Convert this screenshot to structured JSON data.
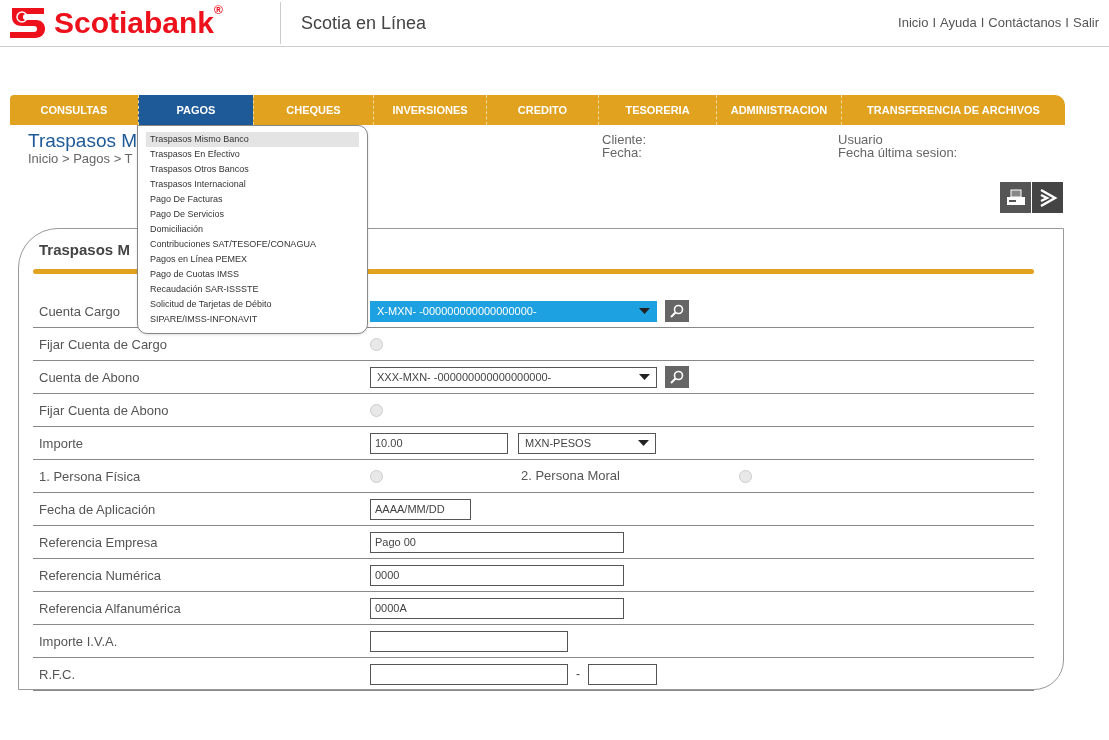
{
  "header": {
    "brand": "Scotiabank$^{®}$",
    "product": "Scotia en Línea",
    "links": [
      "Inicio",
      "Ayuda",
      "Contáctanos",
      "Salir"
    ],
    "separators": [
      "I",
      "I",
      "I"
    ]
  },
  "nav": [
    {
      "label": "CONSULTAS",
      "selected": false
    },
    {
      "label": "PAGOS",
      "selected": true
    },
    {
      "label": "CHEQUES",
      "selected": false
    },
    {
      "label": "INVERSIONES",
      "selected": false
    },
    {
      "label": "CREDITO",
      "selected": false
    },
    {
      "label": "TESORERIA",
      "selected": false
    },
    {
      "label": "ADMINISTRACION",
      "selected": false
    },
    {
      "label": "TRANSFERENCIA DE ARCHIVOS",
      "selected": false
    }
  ],
  "menu": [
    {
      "label": "Traspasos Mismo Banco",
      "selected": true
    },
    {
      "label": "Traspasos En Efectivo",
      "selected": false
    },
    {
      "label": "Traspasos Otros Bancos",
      "selected": false
    },
    {
      "label": "Traspasos Internacional",
      "selected": false
    },
    {
      "label": "Pago De Facturas",
      "selected": false
    },
    {
      "label": "Pago De Servicios",
      "selected": false
    },
    {
      "label": "Domiciliación",
      "selected": false
    },
    {
      "label": "Contribuciones SAT/TESOFE/CONAGUA",
      "selected": false
    },
    {
      "label": "Pagos en Línea PEMEX",
      "selected": false
    },
    {
      "label": "Pago de Cuotas IMSS",
      "selected": false
    },
    {
      "label": "Recaudación SAR-ISSSTE",
      "selected": false
    },
    {
      "label": "Solicitud de Tarjetas de Débito",
      "selected": false
    },
    {
      "label": "SIPARE/IMSS-INFONAVIT",
      "selected": false
    }
  ],
  "page_title": "Traspasos M",
  "breadcrumb": "Inicio > Pagos > T",
  "info": {
    "cliente": "Cliente:",
    "fecha": "Fecha:",
    "usuario": "Usuario",
    "ultima_sesion": "Fecha última sesion:"
  },
  "form": {
    "title": "Traspasos M",
    "rows": [
      {
        "kind": "select",
        "label": "Cuenta Cargo",
        "value": "X-MXN-  -000000000000000000-",
        "focused": true
      },
      {
        "kind": "radio",
        "label": "Fijar Cuenta de Cargo",
        "checked": false
      },
      {
        "kind": "select",
        "label": "Cuenta de Abono",
        "value": "XXX-MXN-  -000000000000000000-",
        "focused": false
      },
      {
        "kind": "radio",
        "label": "Fijar Cuenta de Abono",
        "checked": false
      },
      {
        "kind": "amount",
        "label": "Importe",
        "value": "10.00",
        "currency": "MXN-PESOS"
      },
      {
        "kind": "radio_pair",
        "label": "1. Persona Física",
        "checked": false,
        "label_2": "2. Persona Moral",
        "checked_2": false
      },
      {
        "kind": "date",
        "label": "Fecha de Aplicación",
        "value": "AAAA/MM/DD"
      },
      {
        "kind": "text",
        "label": "Referencia Empresa",
        "value": "Pago 00"
      },
      {
        "kind": "text",
        "label": "Referencia Numérica",
        "value": "0000"
      },
      {
        "kind": "text",
        "label": "Referencia Alfanumérica",
        "value": "0000A"
      },
      {
        "kind": "amount_short",
        "label": "Importe I.V.A."
      },
      {
        "kind": "split",
        "label": "R.F.C.",
        "separator": "-"
      }
    ]
  }
}
